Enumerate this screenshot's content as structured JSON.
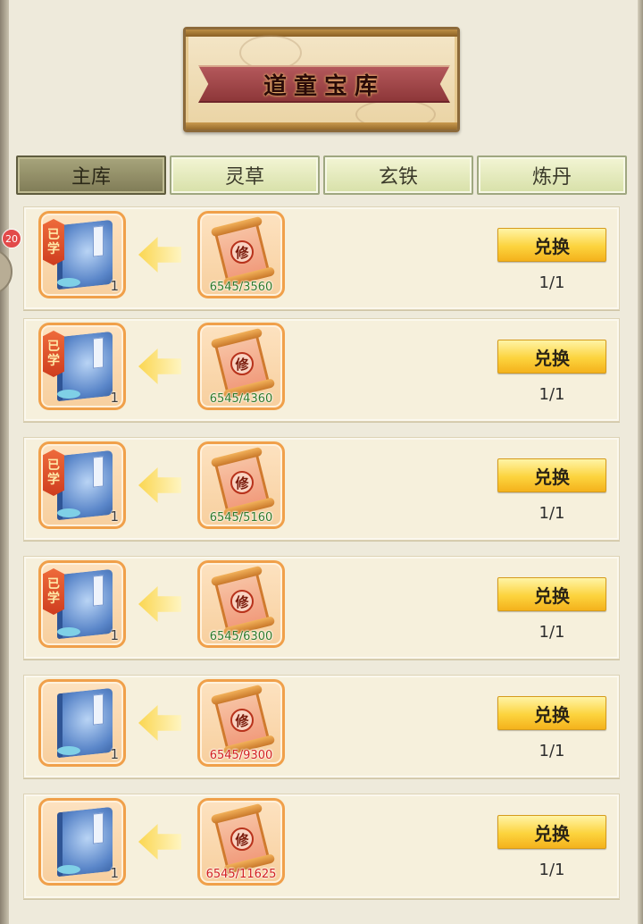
{
  "header": {
    "title": "道童宝库"
  },
  "side_badge": "20",
  "tabs": [
    {
      "label": "主库",
      "active": true
    },
    {
      "label": "灵草",
      "active": false
    },
    {
      "label": "玄铁",
      "active": false
    },
    {
      "label": "炼丹",
      "active": false
    }
  ],
  "items": [
    {
      "learned": true,
      "learned_label": "已学",
      "count": "1",
      "cost_icon_char": "修",
      "progress": "6545/3560",
      "enough": true,
      "button": "兑换",
      "limit": "1/1"
    },
    {
      "learned": true,
      "learned_label": "已学",
      "count": "1",
      "cost_icon_char": "修",
      "progress": "6545/4360",
      "enough": true,
      "button": "兑换",
      "limit": "1/1"
    },
    {
      "learned": true,
      "learned_label": "已学",
      "count": "1",
      "cost_icon_char": "修",
      "progress": "6545/5160",
      "enough": true,
      "button": "兑换",
      "limit": "1/1"
    },
    {
      "learned": true,
      "learned_label": "已学",
      "count": "1",
      "cost_icon_char": "修",
      "progress": "6545/6300",
      "enough": true,
      "button": "兑换",
      "limit": "1/1"
    },
    {
      "learned": false,
      "learned_label": "",
      "count": "1",
      "cost_icon_char": "修",
      "progress": "6545/9300",
      "enough": false,
      "button": "兑换",
      "limit": "1/1"
    },
    {
      "learned": false,
      "learned_label": "",
      "count": "1",
      "cost_icon_char": "修",
      "progress": "6545/11625",
      "enough": false,
      "button": "兑换",
      "limit": "1/1"
    }
  ],
  "colors": {
    "enough": "#2f7a2a",
    "lack": "#d32020",
    "accent": "#f0a04a"
  }
}
